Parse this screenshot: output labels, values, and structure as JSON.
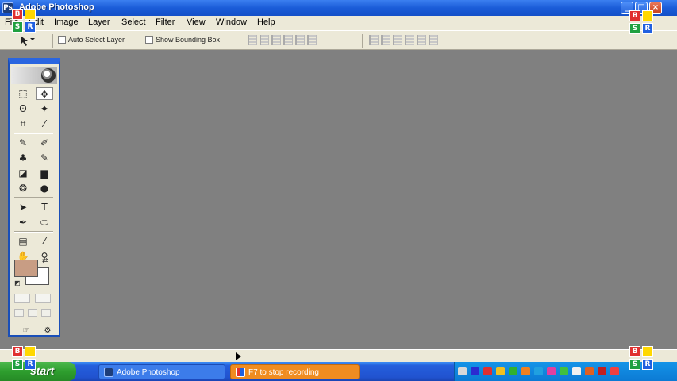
{
  "window": {
    "title": "Adobe Photoshop",
    "app_icon_glyph": "Ps",
    "buttons": {
      "minimize": "_",
      "maximize": "□",
      "close": "×"
    }
  },
  "watermark": {
    "letters": [
      "B",
      "",
      "S",
      "R"
    ]
  },
  "menu": {
    "items": [
      "File",
      "Edit",
      "Image",
      "Layer",
      "Select",
      "Filter",
      "View",
      "Window",
      "Help"
    ]
  },
  "options": {
    "auto_select_layer": "Auto Select Layer",
    "show_bounding_box": "Show Bounding Box"
  },
  "toolbox": {
    "tools": [
      {
        "name": "marquee-tool",
        "glyph": "⬚"
      },
      {
        "name": "move-tool",
        "glyph": "✥"
      },
      {
        "name": "lasso-tool",
        "glyph": "ʘ"
      },
      {
        "name": "magic-wand-tool",
        "glyph": "✦"
      },
      {
        "name": "crop-tool",
        "glyph": "⌗"
      },
      {
        "name": "slice-tool",
        "glyph": "⁄"
      },
      {
        "name": "healing-brush-tool",
        "glyph": "✎"
      },
      {
        "name": "brush-tool",
        "glyph": "✐"
      },
      {
        "name": "clone-stamp-tool",
        "glyph": "♣"
      },
      {
        "name": "history-brush-tool",
        "glyph": "✎"
      },
      {
        "name": "eraser-tool",
        "glyph": "◪"
      },
      {
        "name": "gradient-tool",
        "glyph": "▆"
      },
      {
        "name": "blur-tool",
        "glyph": "❂"
      },
      {
        "name": "dodge-tool",
        "glyph": "●"
      },
      {
        "name": "path-selection-tool",
        "glyph": "➤"
      },
      {
        "name": "type-tool",
        "glyph": "T"
      },
      {
        "name": "pen-tool",
        "glyph": "✒"
      },
      {
        "name": "shape-tool",
        "glyph": "⬭"
      },
      {
        "name": "notes-tool",
        "glyph": "▤"
      },
      {
        "name": "eyedropper-tool",
        "glyph": "⁄"
      },
      {
        "name": "hand-tool",
        "glyph": "✋"
      },
      {
        "name": "zoom-tool",
        "glyph": "⚲"
      }
    ],
    "foreground_color": "#c89d84",
    "background_color": "#ffffff"
  },
  "taskbar": {
    "start_label": "start",
    "tasks": [
      {
        "label": "Adobe Photoshop"
      },
      {
        "label": "F7 to stop recording"
      }
    ]
  },
  "colors": {
    "workspace": "#808080",
    "titlebar": "#1a5cd8",
    "recording": "#f08c20"
  }
}
